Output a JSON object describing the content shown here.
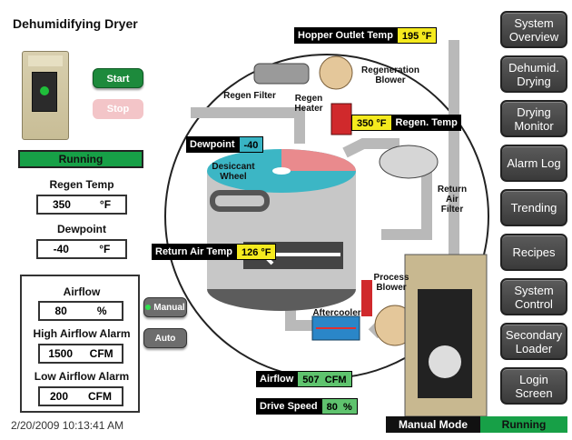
{
  "title": "Dehumidifying Dryer",
  "controls": {
    "start_label": "Start",
    "stop_label": "Stop",
    "status": "Running"
  },
  "regen_temp": {
    "label": "Regen Temp",
    "value": "350",
    "unit": "°F"
  },
  "dewpoint": {
    "label": "Dewpoint",
    "value": "-40",
    "unit": "°F"
  },
  "airflow_group": {
    "airflow": {
      "label": "Airflow",
      "value": "80",
      "unit": "%"
    },
    "high_alarm": {
      "label": "High Airflow Alarm",
      "value": "1500",
      "unit": "CFM"
    },
    "low_alarm": {
      "label": "Low Airflow Alarm",
      "value": "200",
      "unit": "CFM"
    },
    "manual_label": "Manual",
    "auto_label": "Auto"
  },
  "timestamp": "2/20/2009 10:13:41 AM",
  "nav": [
    {
      "label": "System Overview"
    },
    {
      "label": "Dehumid. Drying"
    },
    {
      "label": "Drying Monitor"
    },
    {
      "label": "Alarm Log"
    },
    {
      "label": "Trending"
    },
    {
      "label": "Recipes"
    },
    {
      "label": "System Control"
    },
    {
      "label": "Secondary Loader"
    },
    {
      "label": "Login Screen"
    }
  ],
  "diagram": {
    "hopper_outlet": {
      "label": "Hopper Outlet Temp",
      "value": "195 °F"
    },
    "regen_temp": {
      "value": "350 °F",
      "label": "Regen. Temp"
    },
    "dewpoint": {
      "label": "Dewpoint",
      "value": "-40"
    },
    "return_air": {
      "label": "Return Air Temp",
      "value": "126 °F"
    },
    "airflow": {
      "label": "Airflow",
      "value": "507",
      "unit": "CFM"
    },
    "drive_speed": {
      "label": "Drive Speed",
      "value": "80",
      "unit": "%"
    },
    "labels": {
      "regen_blower": "Regeneration Blower",
      "regen_filter": "Regen Filter",
      "regen_heater": "Regen Heater",
      "desiccant_wheel": "Desiccant Wheel",
      "return_air_filter": "Return Air Filter",
      "process_blower": "Process Blower",
      "aftercooler": "Aftercooler"
    }
  },
  "footer": {
    "mode": "Manual Mode",
    "state": "Running"
  },
  "colors": {
    "green": "#17a047",
    "yellow": "#f5ea1e",
    "cyan": "#38b3c3",
    "nav": "#4a4a4a"
  }
}
